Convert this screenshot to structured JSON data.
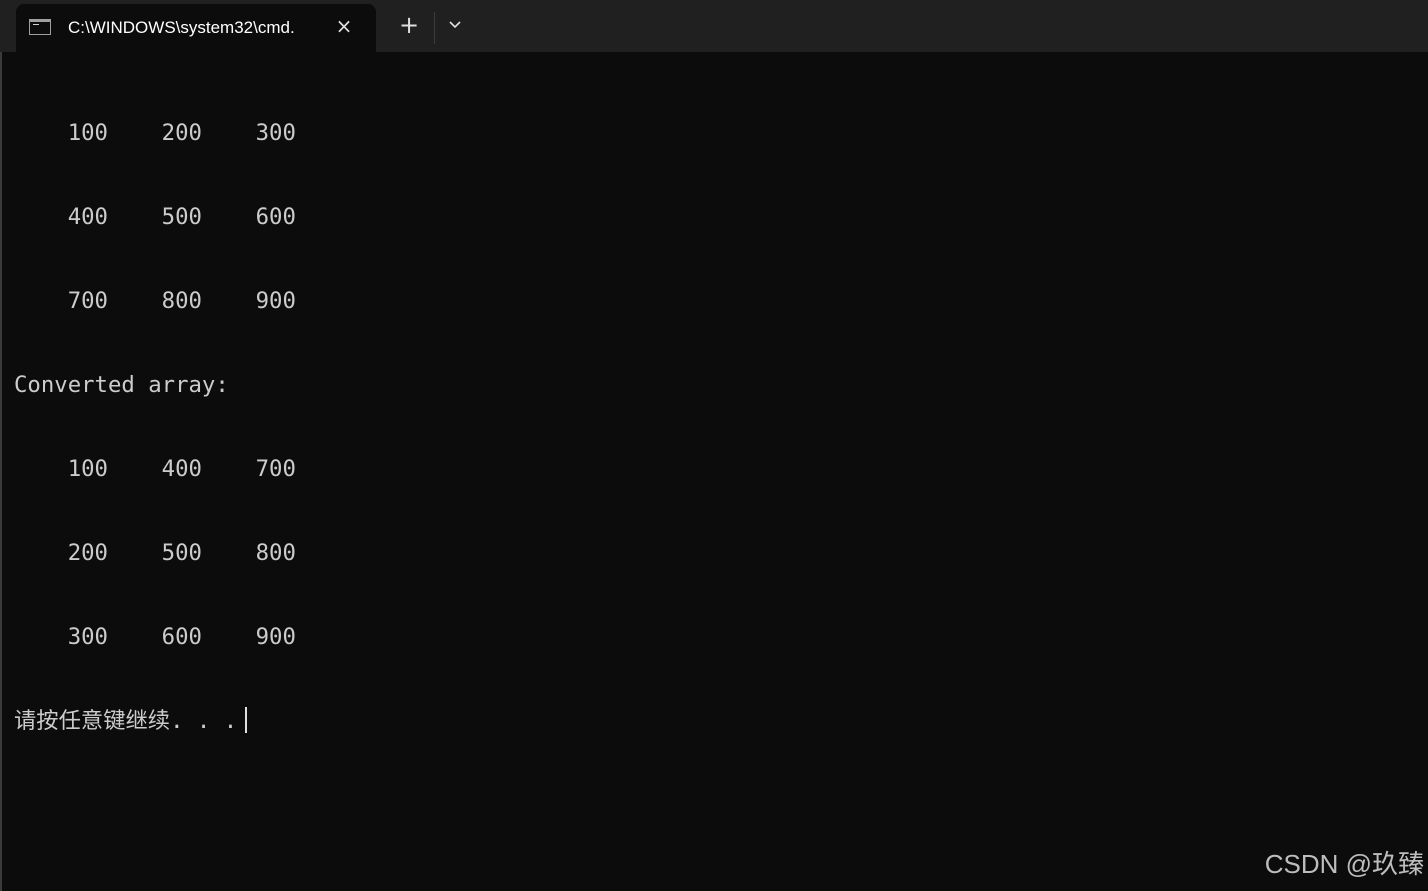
{
  "tab": {
    "title": "C:\\WINDOWS\\system32\\cmd.",
    "icon": "terminal-icon",
    "close_icon": "×",
    "new_tab_icon": "+",
    "dropdown_icon": "chevron-down-icon"
  },
  "console": {
    "lines": [
      "    100    200    300",
      "    400    500    600",
      "    700    800    900",
      "Converted array:",
      "    100    400    700",
      "    200    500    800",
      "    300    600    900"
    ],
    "prompt": "请按任意键继续. . ."
  },
  "watermark": "CSDN @玖臻",
  "colors": {
    "background": "#0c0c0c",
    "tabbar": "#202020",
    "text": "#cccccc"
  }
}
